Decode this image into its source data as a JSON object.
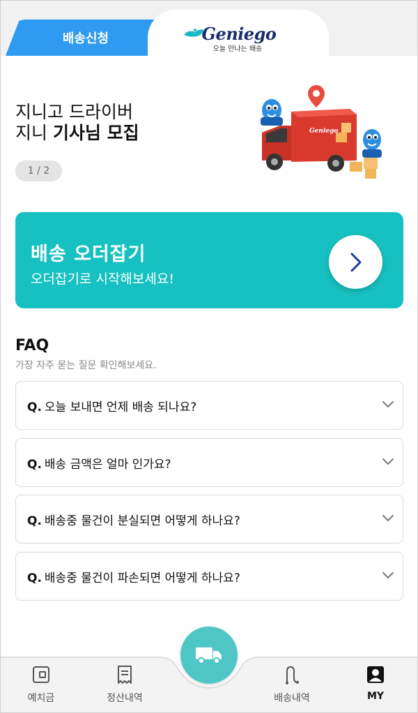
{
  "header": {
    "tab_apply_label": "배송신청",
    "logo_name": "Geniego",
    "logo_sub": "오늘 만나는 배송"
  },
  "banner": {
    "title_line1": "지니고 드라이버",
    "title_line2_plain": "지니",
    "title_line2_bold": "기사님 모집",
    "pager": "1 / 2",
    "truck_text": "Geniego"
  },
  "order_card": {
    "title": "배송 오더잡기",
    "subtitle": "오더잡기로 시작해보세요!"
  },
  "faq": {
    "title": "FAQ",
    "subtitle": "가장 자주 묻는 질문 확인해보세요.",
    "prefix": "Q.",
    "items": [
      "오늘 보내면 언제 배송 되나요?",
      "배송 금액은 얼마 인가요?",
      "배송중 물건이 분실되면 어떻게 하나요?",
      "배송중 물건이 파손되면 어떻게 하나요?"
    ]
  },
  "bottom_nav": {
    "items": [
      "예치금",
      "정산내역",
      "배송내역",
      "MY"
    ],
    "active": "MY"
  },
  "colors": {
    "primary_blue": "#2f9af2",
    "teal": "#17c1c1",
    "center_button": "#4fc6c6"
  }
}
